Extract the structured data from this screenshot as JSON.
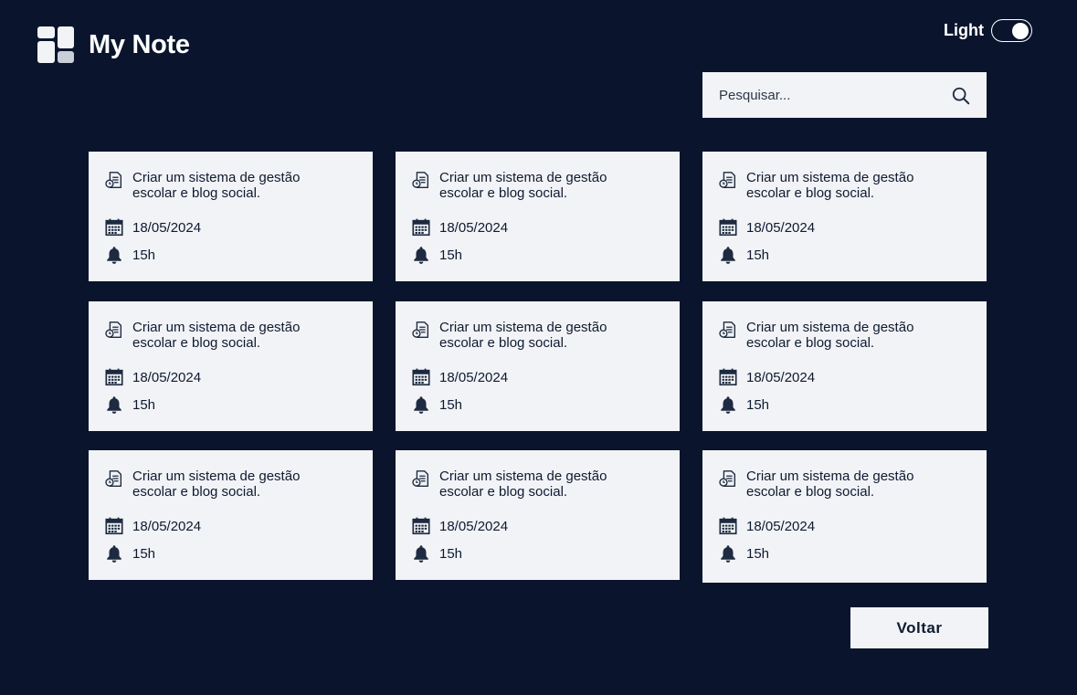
{
  "app": {
    "title": "My Note"
  },
  "theme": {
    "label": "Light",
    "enabled": true
  },
  "search": {
    "placeholder": "Pesquisar...",
    "value": ""
  },
  "icons": {
    "logo": "grid-logo-icon",
    "search": "search-icon",
    "note": "document-clock-icon",
    "date": "calendar-icon",
    "time": "bell-icon"
  },
  "colors": {
    "background": "#0a152d",
    "card": "#f1f3f6",
    "text": "#0f1a30"
  },
  "notes": [
    {
      "title": "Criar um sistema de gestão escolar e blog social.",
      "date": "18/05/2024",
      "time": "15h"
    },
    {
      "title": "Criar um sistema de gestão escolar e blog social.",
      "date": "18/05/2024",
      "time": "15h"
    },
    {
      "title": "Criar um sistema de gestão escolar e blog social.",
      "date": "18/05/2024",
      "time": "15h"
    },
    {
      "title": "Criar um sistema de gestão escolar e blog social.",
      "date": "18/05/2024",
      "time": "15h"
    },
    {
      "title": "Criar um sistema de gestão escolar e blog social.",
      "date": "18/05/2024",
      "time": "15h"
    },
    {
      "title": "Criar um sistema de gestão escolar e blog social.",
      "date": "18/05/2024",
      "time": "15h"
    },
    {
      "title": "Criar um sistema de gestão escolar e blog social.",
      "date": "18/05/2024",
      "time": "15h"
    },
    {
      "title": "Criar um sistema de gestão escolar e blog social.",
      "date": "18/05/2024",
      "time": "15h"
    },
    {
      "title": "Criar um sistema de gestão escolar e blog social.",
      "date": "18/05/2024",
      "time": "15h"
    }
  ],
  "actions": {
    "back_label": "Voltar"
  }
}
